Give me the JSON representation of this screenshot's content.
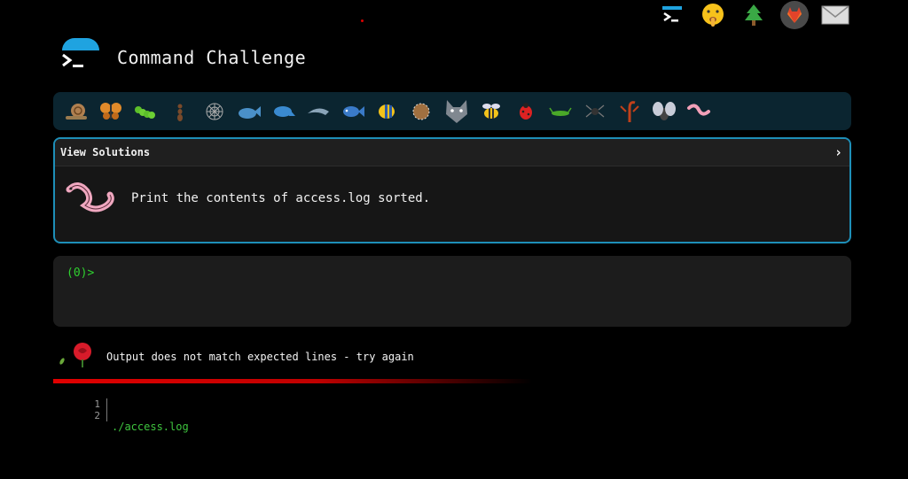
{
  "app": {
    "title": "Command Challenge"
  },
  "top_icons": [
    "terminal-icon",
    "shushing-face-icon",
    "tree-icon",
    "gitlab-icon",
    "envelope-icon"
  ],
  "animals": [
    "snail-icon",
    "butterfly-icon",
    "caterpillar-icon",
    "ant-icon",
    "spider-web-icon",
    "whale-icon",
    "whale2-icon",
    "dolphin-icon",
    "fish-icon",
    "tropical-fish-icon",
    "blowfish-icon",
    "wolf-icon",
    "bee-icon",
    "ladybug-icon",
    "cricket-icon",
    "spider-icon",
    "scorpion-icon",
    "fly-icon",
    "worm-icon"
  ],
  "challenge": {
    "view_solutions_label": "View Solutions",
    "chevron": "›",
    "description": "Print the contents of access.log sorted."
  },
  "terminal": {
    "prompt": "(0)>"
  },
  "status": {
    "message": "Output does not match expected lines - try again"
  },
  "output": {
    "line_numbers": [
      "1",
      "2"
    ],
    "lines": [
      "./access.log",
      ""
    ]
  },
  "colors": {
    "accent": "#1e8fb8",
    "prompt_green": "#2fd02f",
    "error_red": "#e00000",
    "panel_dark": "#0b2530"
  }
}
